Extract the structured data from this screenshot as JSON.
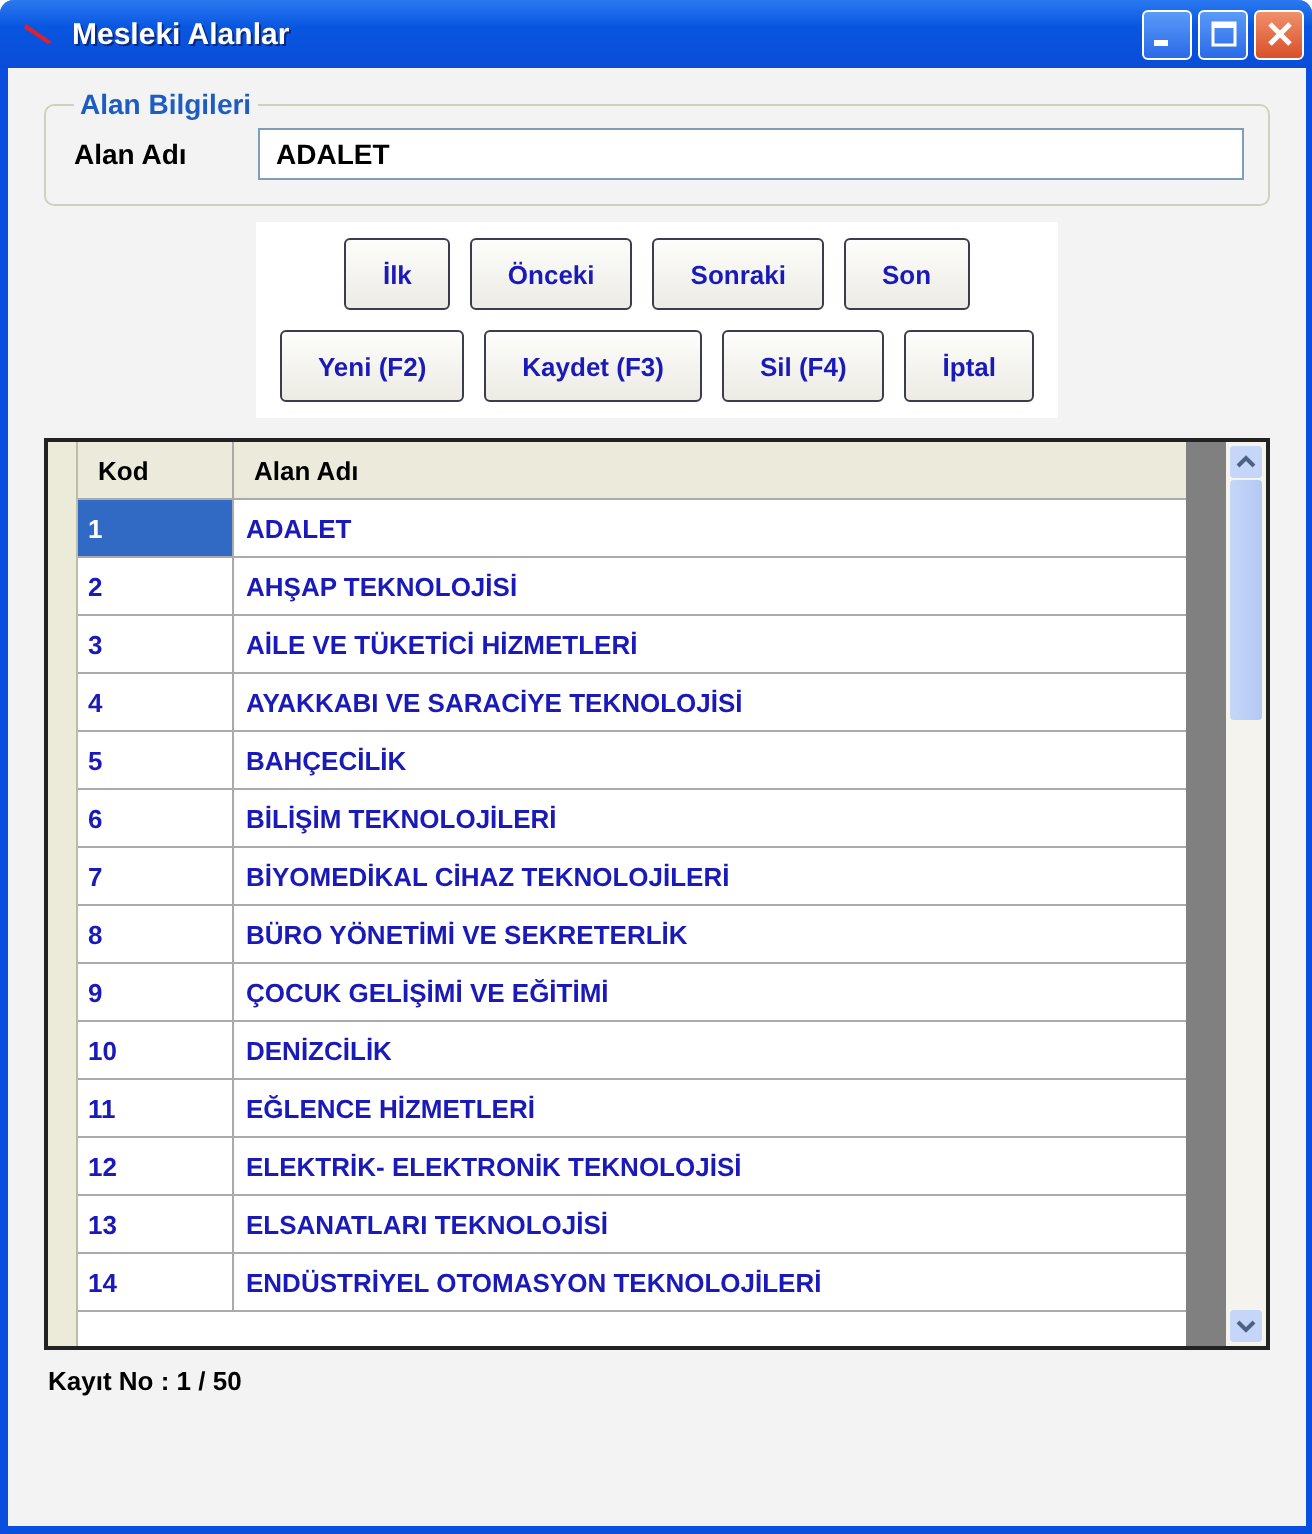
{
  "window": {
    "title": "Mesleki Alanlar"
  },
  "group": {
    "title": "Alan Bilgileri",
    "field_label": "Alan Adı",
    "field_value": "ADALET"
  },
  "nav_buttons": [
    "İlk",
    "Önceki",
    "Sonraki",
    "Son"
  ],
  "action_buttons": [
    "Yeni (F2)",
    "Kaydet (F3)",
    "Sil (F4)",
    "İptal"
  ],
  "table": {
    "columns": [
      "Kod",
      "Alan Adı"
    ],
    "rows": [
      {
        "kod": "1",
        "name": "ADALET",
        "selected": true
      },
      {
        "kod": "2",
        "name": "AHŞAP TEKNOLOJİSİ",
        "selected": false
      },
      {
        "kod": "3",
        "name": "AİLE VE TÜKETİCİ HİZMETLERİ",
        "selected": false
      },
      {
        "kod": "4",
        "name": "AYAKKABI VE SARACİYE TEKNOLOJİSİ",
        "selected": false
      },
      {
        "kod": "5",
        "name": "BAHÇECİLİK",
        "selected": false
      },
      {
        "kod": "6",
        "name": "BİLİŞİM TEKNOLOJİLERİ",
        "selected": false
      },
      {
        "kod": "7",
        "name": "BİYOMEDİKAL CİHAZ TEKNOLOJİLERİ",
        "selected": false
      },
      {
        "kod": "8",
        "name": "BÜRO YÖNETİMİ VE SEKRETERLİK",
        "selected": false
      },
      {
        "kod": "9",
        "name": "ÇOCUK GELİŞİMİ VE EĞİTİMİ",
        "selected": false
      },
      {
        "kod": "10",
        "name": "DENİZCİLİK",
        "selected": false
      },
      {
        "kod": "11",
        "name": "EĞLENCE HİZMETLERİ",
        "selected": false
      },
      {
        "kod": "12",
        "name": "ELEKTRİK- ELEKTRONİK TEKNOLOJİSİ",
        "selected": false
      },
      {
        "kod": "13",
        "name": "ELSANATLARI TEKNOLOJİSİ",
        "selected": false
      },
      {
        "kod": "14",
        "name": "ENDÜSTRİYEL OTOMASYON TEKNOLOJİLERİ",
        "selected": false
      }
    ]
  },
  "status_bar": "Kayıt No : 1 / 50"
}
